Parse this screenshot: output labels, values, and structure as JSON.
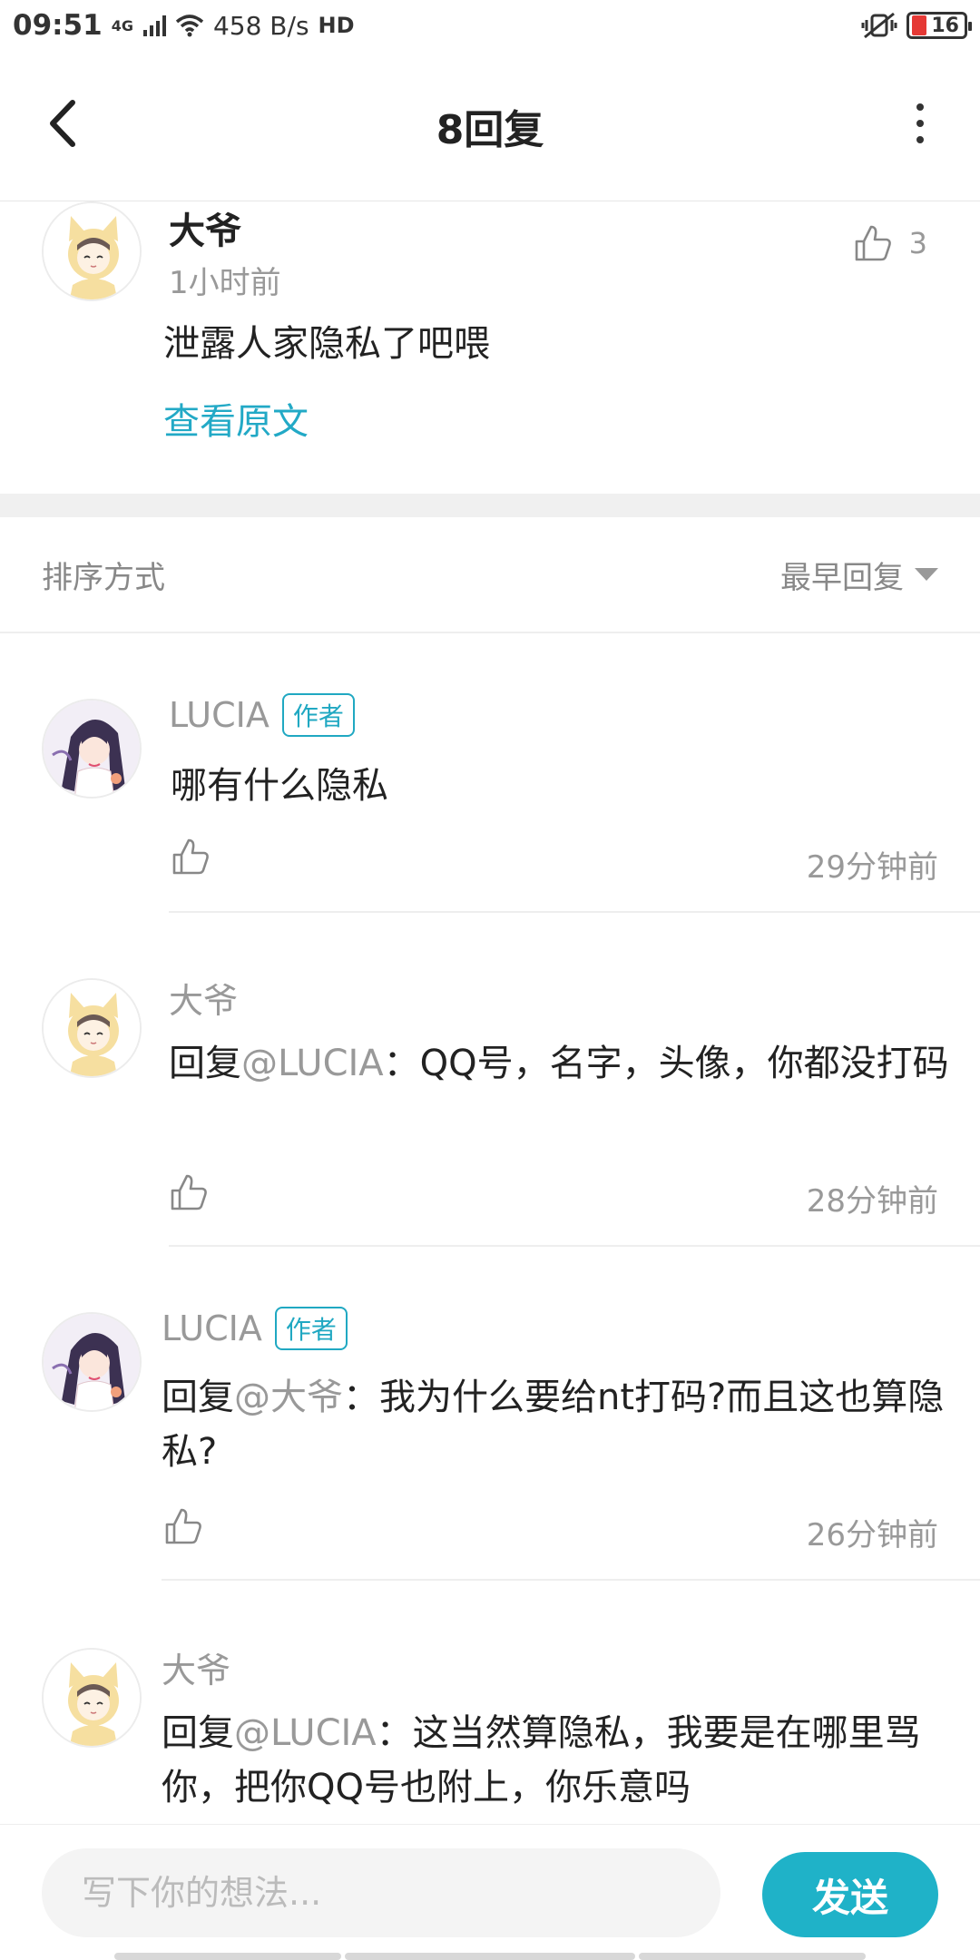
{
  "status_bar": {
    "time": "09:51",
    "network": "4G",
    "speed": "458 B/s",
    "hd": "HD",
    "battery": "16"
  },
  "nav": {
    "title": "8回复"
  },
  "main_comment": {
    "author": "大爷",
    "time": "1小时前",
    "text": "泄露人家隐私了吧喂",
    "view_original": "查看原文",
    "likes": "3"
  },
  "sort": {
    "label": "排序方式",
    "value": "最早回复"
  },
  "replies": [
    {
      "author": "LUCIA",
      "badge": "作者",
      "prefix": "",
      "mention": "",
      "text": "哪有什么隐私",
      "time": "29分钟前"
    },
    {
      "author": "大爷",
      "badge": "",
      "prefix": "回复",
      "mention": "@LUCIA",
      "text": "：QQ号，名字，头像，你都没打码",
      "time": "28分钟前"
    },
    {
      "author": "LUCIA",
      "badge": "作者",
      "prefix": "回复",
      "mention": "@大爷",
      "text": "：我为什么要给nt打码?而且这也算隐私?",
      "time": "26分钟前"
    },
    {
      "author": "大爷",
      "badge": "",
      "prefix": "回复",
      "mention": "@LUCIA",
      "text": "：这当然算隐私，我要是在哪里骂你，把你QQ号也附上，你乐意吗",
      "time": ""
    }
  ],
  "composer": {
    "placeholder": "写下你的想法...",
    "send_label": "发送"
  },
  "colors": {
    "accent": "#1fb2c8",
    "badge": "#20a8c2",
    "muted": "#999999"
  }
}
